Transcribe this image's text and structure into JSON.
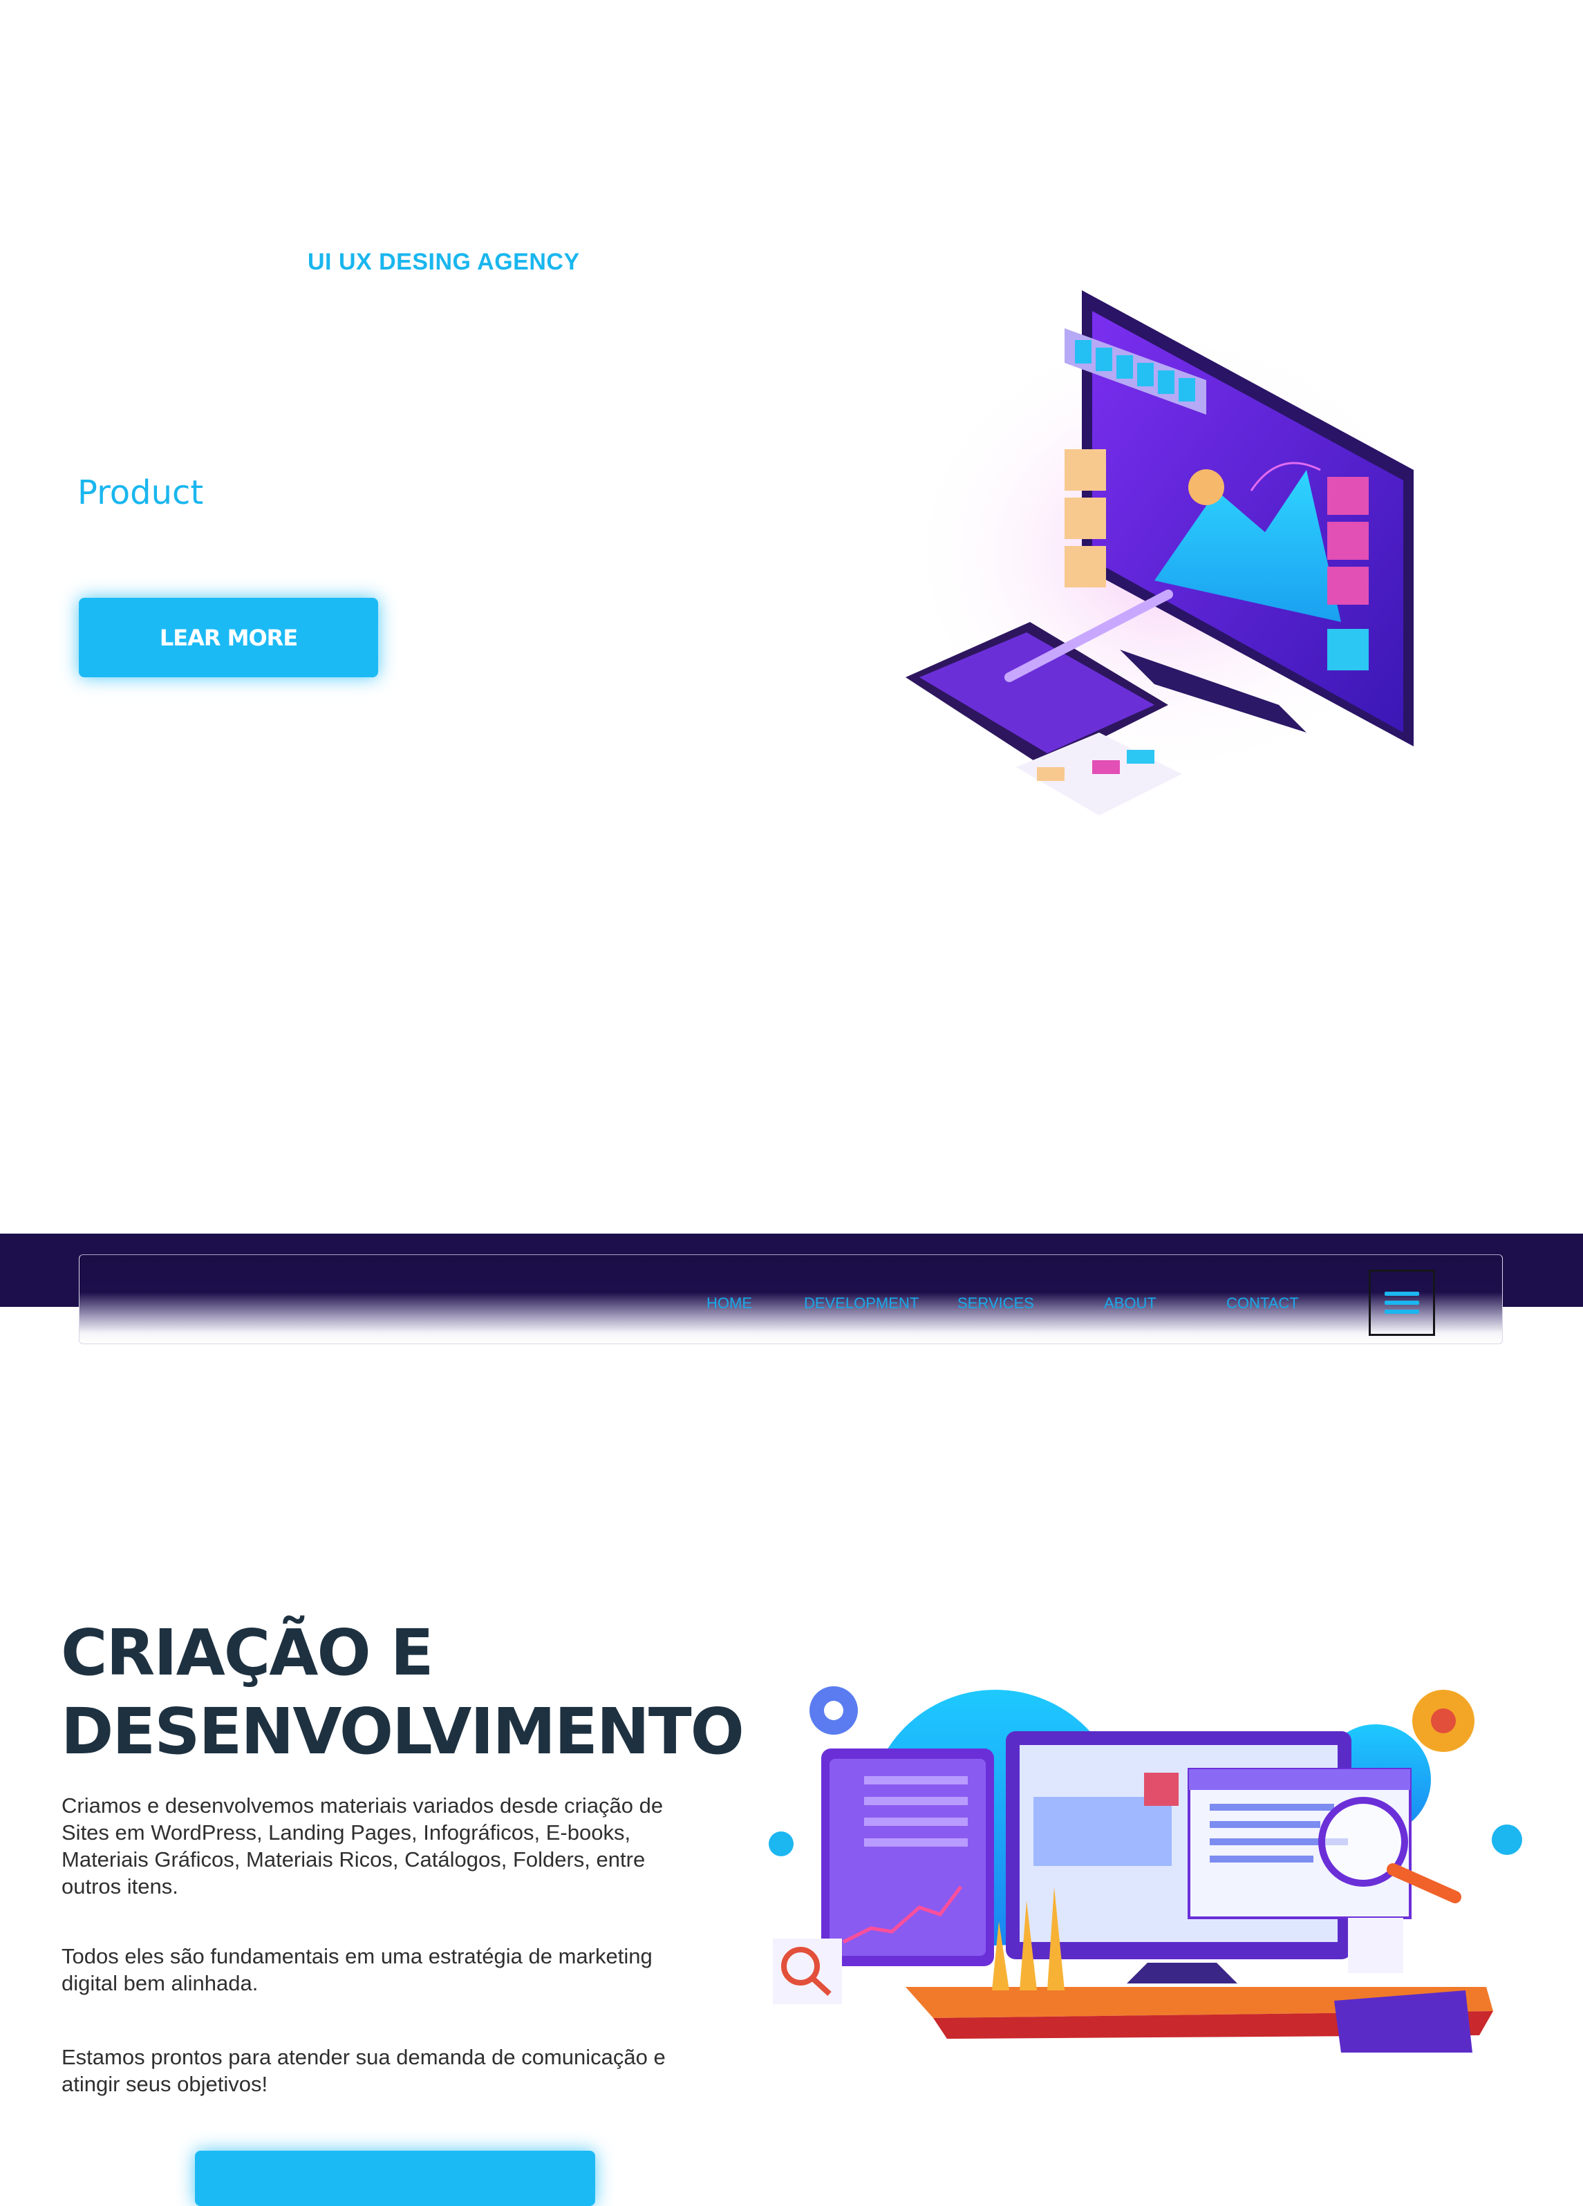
{
  "hero": {
    "eyebrow": "UI UX DESING AGENCY",
    "title": "Product",
    "button_label": "LEAR MORE",
    "illustration_icon": "isometric-computer-design-illustration"
  },
  "nav": {
    "items": [
      "HOME",
      "DEVELOPMENT",
      "SERVICES",
      "ABOUT",
      "CONTACT"
    ],
    "menu_icon": "hamburger-icon"
  },
  "section": {
    "title_line1": "CRIAÇÃO E",
    "title_line2": "DESENVOLVIMENTO",
    "paragraph1": "Criamos e desenvolvemos materiais variados desde criação de Sites em WordPress, Landing Pages, Infográficos, E-books, Materiais Gráficos, Materiais Ricos, Catálogos, Folders, entre outros itens.",
    "paragraph2": "Todos eles são fundamentais em uma estratégia de marketing digital bem alinhada.",
    "paragraph3": "Estamos prontos para atender sua demanda de comunicação e atingir seus objetivos!",
    "illustration_icon": "web-development-workstation-illustration"
  },
  "colors": {
    "accent": "#1cbaf5",
    "nav_dark": "#1d0f4b",
    "heading": "#1e3140",
    "purple": "#6b2fd8"
  }
}
